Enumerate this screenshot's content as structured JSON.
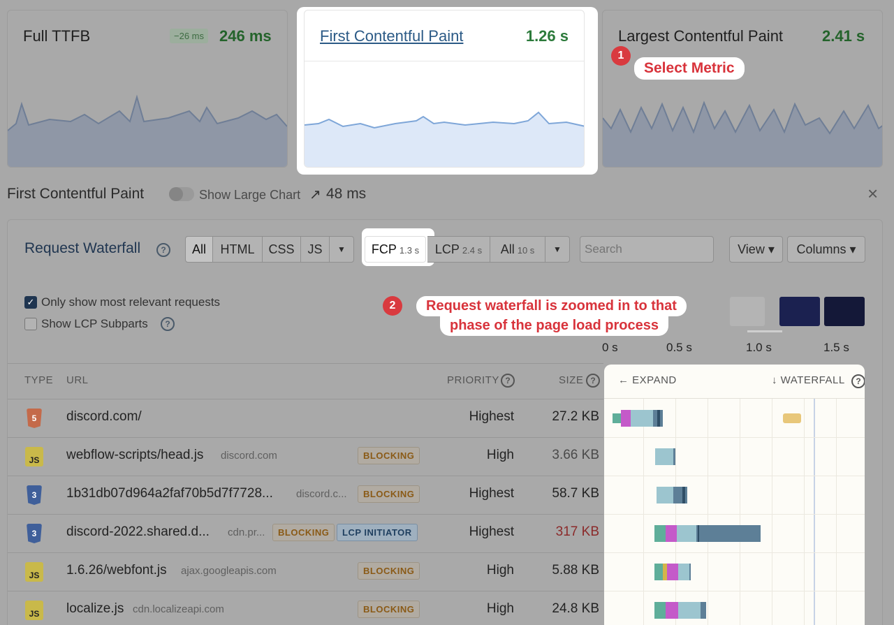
{
  "metrics": {
    "ttfb": {
      "title": "Full TTFB",
      "delta": "−26 ms",
      "value": "246 ms"
    },
    "fcp": {
      "title": "First Contentful Paint",
      "value": "1.26 s"
    },
    "lcp": {
      "title": "Largest Contentful Paint",
      "value": "2.41 s"
    }
  },
  "callouts": {
    "one": {
      "num": "1",
      "text": "Select Metric"
    },
    "two": {
      "num": "2",
      "line1": "Request waterfall is zoomed in to that",
      "line2": "phase of the page load process"
    }
  },
  "detail": {
    "title": "First Contentful Paint",
    "toggle_label": "Show Large Chart",
    "trend": "48 ms",
    "close": "×"
  },
  "waterfall_panel": {
    "title": "Request Waterfall",
    "filters": [
      "All",
      "HTML",
      "CSS",
      "JS"
    ],
    "phases": [
      {
        "label": "FCP",
        "sub": "1.3 s"
      },
      {
        "label": "LCP",
        "sub": "2.4 s"
      },
      {
        "label": "All",
        "sub": "10 s"
      }
    ],
    "search_placeholder": "Search",
    "view_label": "View ▾",
    "columns_label": "Columns ▾",
    "opt_relevant": "Only show most relevant requests",
    "opt_lcp_subparts": "Show LCP Subparts",
    "timeline_ticks": [
      "0 s",
      "0.5 s",
      "1.0 s",
      "1.5 s"
    ]
  },
  "table": {
    "headers": {
      "type": "TYPE",
      "url": "URL",
      "priority": "PRIORITY",
      "size": "SIZE",
      "expand": "← EXPAND",
      "waterfall": "↓ WATERFALL"
    },
    "rows": [
      {
        "type": "html",
        "url": "discord.com/",
        "domain": "",
        "tags": [],
        "priority": "Highest",
        "size": "27.2 KB"
      },
      {
        "type": "js",
        "url": "webflow-scripts/head.js",
        "domain": "discord.com",
        "tags": [
          "BLOCKING"
        ],
        "priority": "High",
        "size": "3.66 KB"
      },
      {
        "type": "css",
        "url": "1b31db07d964a2faf70b5d7f7728...",
        "domain": "discord.c...",
        "tags": [
          "BLOCKING"
        ],
        "priority": "Highest",
        "size": "58.7 KB"
      },
      {
        "type": "css",
        "url": "discord-2022.shared.d...",
        "domain": "cdn.pr...",
        "tags": [
          "BLOCKING",
          "LCP INITIATOR"
        ],
        "priority": "Highest",
        "size": "317 KB"
      },
      {
        "type": "js",
        "url": "1.6.26/webfont.js",
        "domain": "ajax.googleapis.com",
        "tags": [
          "BLOCKING"
        ],
        "priority": "High",
        "size": "5.88 KB"
      },
      {
        "type": "js",
        "url": "localize.js",
        "domain": "cdn.localizeapi.com",
        "tags": [
          "BLOCKING"
        ],
        "priority": "High",
        "size": "24.8 KB"
      }
    ]
  },
  "icon_labels": {
    "js": "JS"
  },
  "colors": {
    "good": "#2c7a3b",
    "accent": "#d93a3f",
    "link": "#2b5a86"
  }
}
